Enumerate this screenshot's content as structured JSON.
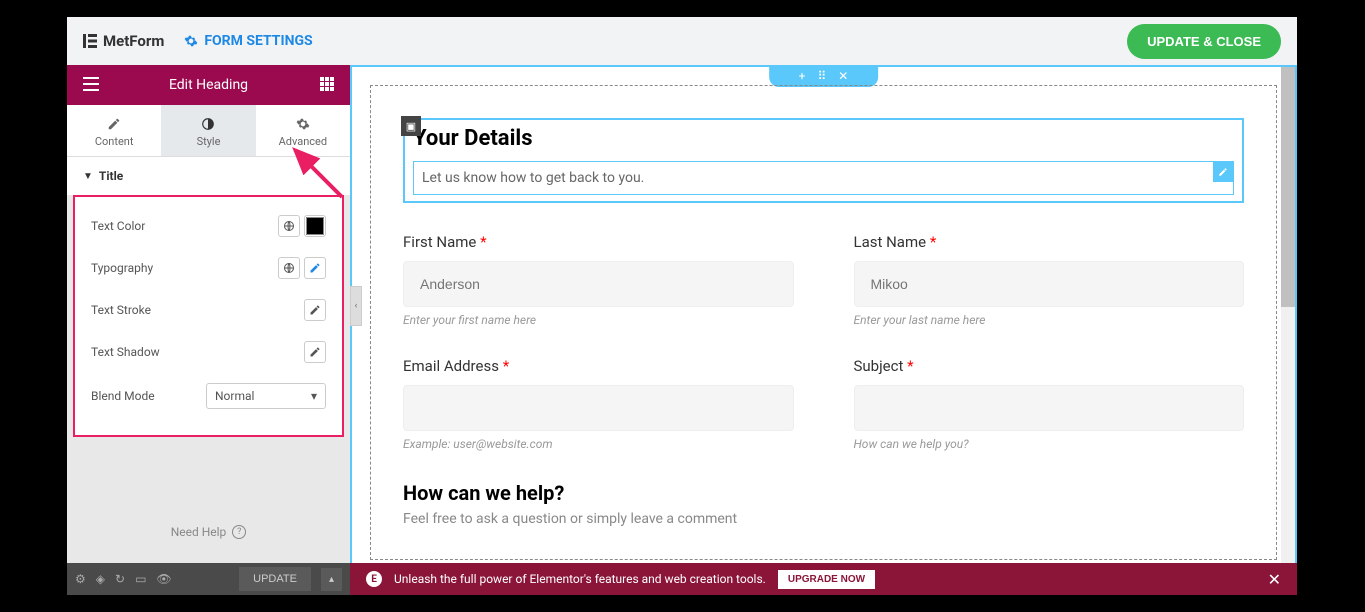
{
  "topbar": {
    "logo": "MetForm",
    "form_settings": "FORM SETTINGS",
    "update_close": "UPDATE & CLOSE"
  },
  "sidebar": {
    "title": "Edit Heading",
    "tabs": {
      "content": "Content",
      "style": "Style",
      "advanced": "Advanced"
    },
    "section": "Title",
    "controls": {
      "text_color": "Text Color",
      "typography": "Typography",
      "text_stroke": "Text Stroke",
      "text_shadow": "Text Shadow",
      "blend_mode": "Blend Mode",
      "blend_mode_value": "Normal"
    },
    "need_help": "Need Help"
  },
  "bottombar": {
    "update": "UPDATE"
  },
  "canvas": {
    "heading_title": "Your Details",
    "heading_subtitle": "Let us know how to get back to you.",
    "fields": {
      "first_name": {
        "label": "First Name",
        "placeholder": "Anderson",
        "hint": "Enter your first name here"
      },
      "last_name": {
        "label": "Last Name",
        "placeholder": "Mikoo",
        "hint": "Enter your last name here"
      },
      "email": {
        "label": "Email Address",
        "hint": "Example: user@website.com"
      },
      "subject": {
        "label": "Subject",
        "hint": "How can we help you?"
      }
    },
    "section2_title": "How can we help?",
    "section2_sub": "Feel free to ask a question or simply leave a comment"
  },
  "notice": {
    "text": "Unleash the full power of Elementor's features and web creation tools.",
    "upgrade": "UPGRADE NOW"
  }
}
